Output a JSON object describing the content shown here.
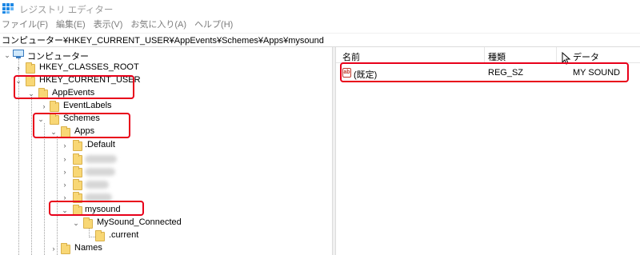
{
  "window": {
    "title": "レジストリ エディター",
    "app_icon": "registry-editor-icon"
  },
  "menu": [
    "ファイル(F)",
    "編集(E)",
    "表示(V)",
    "お気に入り(A)",
    "ヘルプ(H)"
  ],
  "address": "コンピューター¥HKEY_CURRENT_USER¥AppEvents¥Schemes¥Apps¥mysound",
  "tree": {
    "computer": "コンピューター",
    "hkcr": "HKEY_CLASSES_ROOT",
    "hkcu": "HKEY_CURRENT_USER",
    "appevents": "AppEvents",
    "eventlabels": "EventLabels",
    "schemes": "Schemes",
    "apps": "Apps",
    "default": ".Default",
    "mysound": "mysound",
    "mysound_connected": "MySound_Connected",
    "current": ".current",
    "names": "Names"
  },
  "list": {
    "columns": [
      "名前",
      "種類",
      "データ"
    ],
    "rows": [
      {
        "name": "(既定)",
        "type": "REG_SZ",
        "data": "MY SOUND",
        "icon": "string-value-icon"
      }
    ]
  },
  "highlight_color": "#e8001a",
  "folder_color": "#f8d775"
}
